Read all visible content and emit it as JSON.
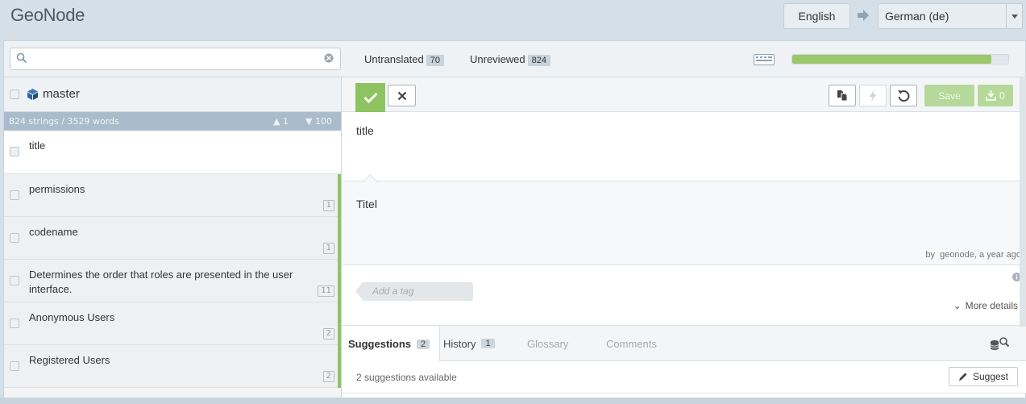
{
  "header": {
    "brand": "GeoNode",
    "source_language": "English",
    "target_language": "German (de)"
  },
  "stats": {
    "search_value": "",
    "untranslated_label": "Untranslated",
    "untranslated_count": "70",
    "unreviewed_label": "Unreviewed",
    "unreviewed_count": "824",
    "progress_fraction": 0.92,
    "progress_color": "#9bc86b"
  },
  "sidebar": {
    "project_name": "master",
    "summary": "824 strings / 3529 words",
    "sort_up": "1",
    "sort_down": "100",
    "units": [
      {
        "text": "title",
        "count": "",
        "selected": true
      },
      {
        "text": "permissions",
        "count": "1"
      },
      {
        "text": "codename",
        "count": "1"
      },
      {
        "text": "Determines the order that roles are presented in the user interface.",
        "count": "11"
      },
      {
        "text": "Anonymous Users",
        "count": "2"
      },
      {
        "text": "Registered Users",
        "count": "2"
      }
    ]
  },
  "editor": {
    "save_label": "Save",
    "download_count": "0",
    "source_text": "title",
    "target_text": "Titel",
    "meta_by": "by",
    "meta_user": "geonode",
    "meta_time": ", a year ago",
    "tag_placeholder": "Add a tag",
    "more_details": "More details"
  },
  "tabs": [
    {
      "label": "Suggestions",
      "count": "2"
    },
    {
      "label": "History",
      "count": "1"
    },
    {
      "label": "Glossary"
    },
    {
      "label": "Comments"
    }
  ],
  "suggestions": {
    "summary": "2 suggestions available",
    "suggest_label": "Suggest"
  },
  "colors": {
    "accent_green": "#8dc461",
    "header_bg": "#d5dfe8",
    "count_bar": "#aabccb"
  }
}
